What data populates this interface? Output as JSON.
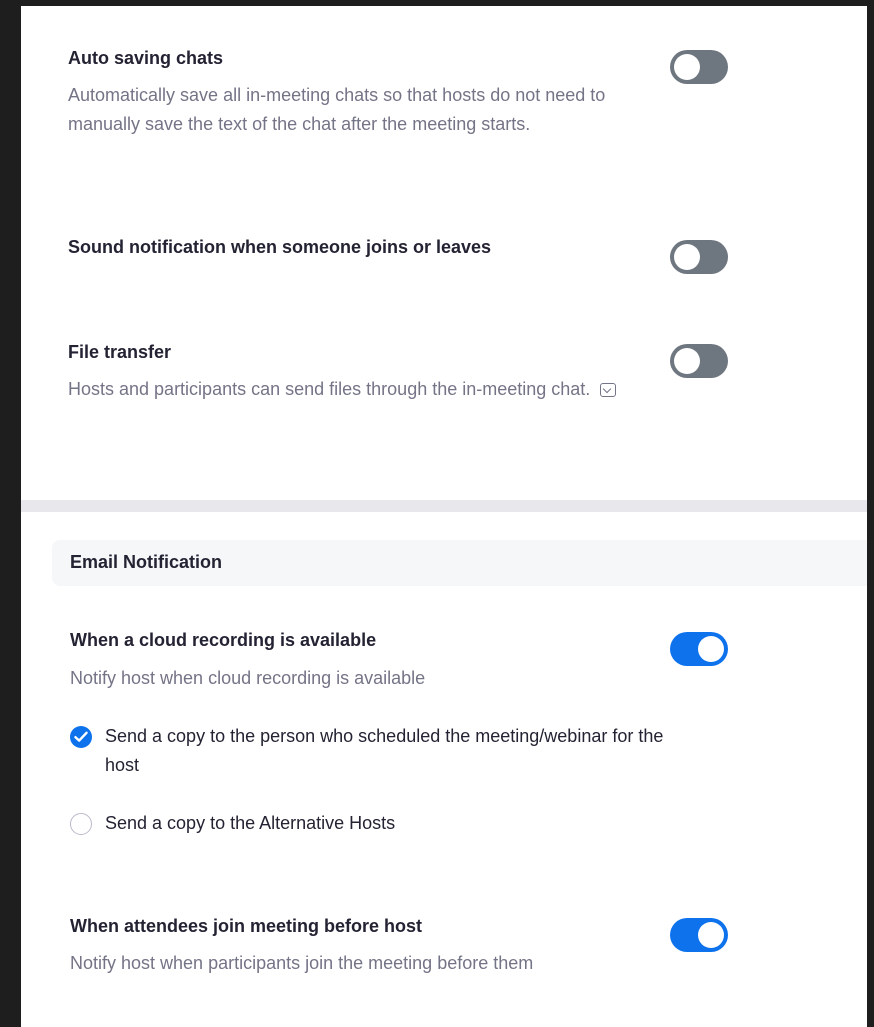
{
  "settings": {
    "auto_saving": {
      "title": "Auto saving chats",
      "description": "Automatically save all in-meeting chats so that hosts do not need to manually save the text of the chat after the meeting starts.",
      "enabled": false
    },
    "sound_notification": {
      "title": "Sound notification when someone joins or leaves",
      "enabled": false
    },
    "file_transfer": {
      "title": "File transfer",
      "description": "Hosts and participants can send files through the in-meeting chat.",
      "enabled": false,
      "info_icon": "tooltip-icon"
    }
  },
  "email_section": {
    "header": "Email Notification",
    "cloud_recording": {
      "title": "When a cloud recording is available",
      "description": "Notify host when cloud recording is available",
      "enabled": true,
      "options": [
        {
          "label": "Send a copy to the person who scheduled the meeting/webinar for the host",
          "checked": true
        },
        {
          "label": "Send a copy to the Alternative Hosts",
          "checked": false
        }
      ]
    },
    "join_before_host": {
      "title": "When attendees join meeting before host",
      "description": "Notify host when participants join the meeting before them",
      "enabled": true
    }
  },
  "colors": {
    "accent": "#0e72ed",
    "toggle_off": "#6e7680",
    "title_text": "#232333",
    "description_text": "#747487"
  }
}
